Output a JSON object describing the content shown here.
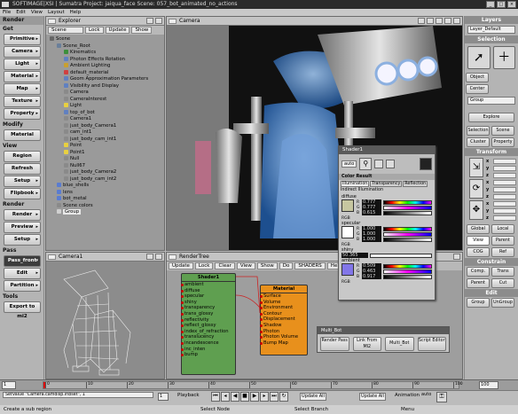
{
  "titlebar": {
    "title": "SOFTIMAGE|XSI | Sumatra Project: jaiqua_face   Scene: 057_bot_animated_no_actions"
  },
  "menu": [
    "File",
    "Edit",
    "View",
    "Layout",
    "Help"
  ],
  "left": {
    "render_header": "Render",
    "get_header": "Get",
    "get_buttons": [
      "Primitive",
      "Camera",
      "Light",
      "Material",
      "Map",
      "Texture",
      "Property"
    ],
    "modify_header": "Modify",
    "modify_buttons": [
      "Material"
    ],
    "view_header": "View",
    "view_buttons": [
      "Region",
      "Refresh",
      "Setup",
      "Flipbook"
    ],
    "render2_header": "Render",
    "render_buttons": [
      "Render",
      "Preview",
      "Setup"
    ],
    "pass_header": "Pass",
    "pass_value": "Pass_front",
    "pass_buttons": [
      "Edit",
      "Partition"
    ],
    "tools_header": "Tools",
    "tools_buttons": [
      "Export to mi2"
    ]
  },
  "explorer": {
    "title": "Explorer",
    "toolbar": [
      "Scene",
      "Lock",
      "Update",
      "Show"
    ],
    "items": [
      "Scene",
      "Scene_Root",
      "Kinematics",
      "Photon Effects Rotation",
      "Ambient Lighting",
      "default_material",
      "Geom Approximation Parameters",
      "Visibility and Display",
      "Camera",
      "CameraInterest",
      "Light",
      "top_of_bot",
      "Camera1",
      "just_body_Camera1",
      "cam_int1",
      "just_body_cam_int1",
      "Point",
      "Point1",
      "Null",
      "Null67",
      "just_body_Camera2",
      "just_body_cam_int2",
      "blue_shells",
      "lens",
      "bot_metal",
      "Scene colors",
      "Group"
    ]
  },
  "camera_view": {
    "title": "Camera"
  },
  "camera1_view": {
    "title": "Camera1"
  },
  "rendertree": {
    "title": "RenderTree",
    "toolbar": [
      "Update",
      "Lock",
      "Clear",
      "View",
      "Show",
      "Do",
      "SHADERS",
      "Help"
    ],
    "shader_node": {
      "title": "Shader1",
      "ports": [
        "ambient",
        "diffuse",
        "specular",
        "shiny",
        "transparency",
        "trans_glossy",
        "reflectivity",
        "reflect_glossy",
        "index_of_refraction",
        "translucency",
        "incandescence",
        "inc_inten",
        "bump"
      ]
    },
    "material_node": {
      "title": "Material",
      "ports": [
        "Surface",
        "Volume",
        "Environment",
        "Contour",
        "Displacement",
        "Shadow",
        "Photon",
        "Photon Volume",
        "Bump Map"
      ]
    }
  },
  "shader_panel": {
    "title": "Shader1",
    "auto": "auto",
    "section": "Color Result",
    "tabs": [
      "Illumination",
      "Transparency",
      "Reflection"
    ],
    "subtab": "Indirect Illumination",
    "diffuse_label": "diffuse",
    "diffuse": [
      {
        "ch": "R",
        "v": "0.777"
      },
      {
        "ch": "G",
        "v": "0.777"
      },
      {
        "ch": "B",
        "v": "0.615"
      }
    ],
    "specular_label": "specular",
    "specular": [
      {
        "ch": "R",
        "v": "1.000"
      },
      {
        "ch": "G",
        "v": "1.000"
      },
      {
        "ch": "B",
        "v": "1.000"
      }
    ],
    "shiny_label": "shiny",
    "shiny_value": "50.365",
    "ambient_label": "ambient",
    "ambient": [
      {
        "ch": "R",
        "v": "0.509"
      },
      {
        "ch": "G",
        "v": "0.463"
      },
      {
        "ch": "B",
        "v": "0.917"
      }
    ],
    "mode": "RGB",
    "colors": {
      "diffuse": "#c6c6a0",
      "specular": "#ffffff",
      "ambient": "#8276e8"
    }
  },
  "multibot": {
    "title": "Multi_Bot",
    "buttons": [
      "Render Pass",
      "Link From MI2",
      "Multi_Bot",
      "Script Editor"
    ]
  },
  "right": {
    "layers_header": "Layers",
    "layer_value": "Layer_Default",
    "selection_header": "Selection",
    "select_buttons": [
      "Object",
      "Center"
    ],
    "group_value": "Group",
    "explore": "Explore",
    "sel_buttons": [
      "Selection",
      "Scene",
      "Cluster",
      "Property"
    ],
    "transform_header": "Transform",
    "axes": [
      "x",
      "y",
      "z",
      "x",
      "y",
      "z",
      "x",
      "y",
      "z"
    ],
    "global_local": [
      "Global",
      "Local"
    ],
    "view_parent": [
      "View",
      "Parent"
    ],
    "cog_ref": [
      "COG",
      "Ref"
    ],
    "constrain_header": "Constrain",
    "constrain_buttons": [
      "Comp.",
      "Trans",
      "Parent",
      "Cut"
    ],
    "edit_header": "Edit",
    "edit_buttons": [
      "Group",
      "UnGroup"
    ]
  },
  "timeline": {
    "start": "1",
    "end": "100",
    "ticks": [
      "0",
      "10",
      "20",
      "30",
      "40",
      "50",
      "60",
      "70",
      "80",
      "90",
      "100"
    ]
  },
  "playbar": {
    "command": "SetValue \"Camera.camdisp.inbset\", 1",
    "frame": "1",
    "playback": "Playback",
    "animation": "Animation",
    "auto": "auto",
    "key_buttons": [
      "Update All"
    ]
  },
  "status": {
    "left": "Create a sub region",
    "mid": "Select Node",
    "right": "Select Branch",
    "menu": "Menu"
  }
}
